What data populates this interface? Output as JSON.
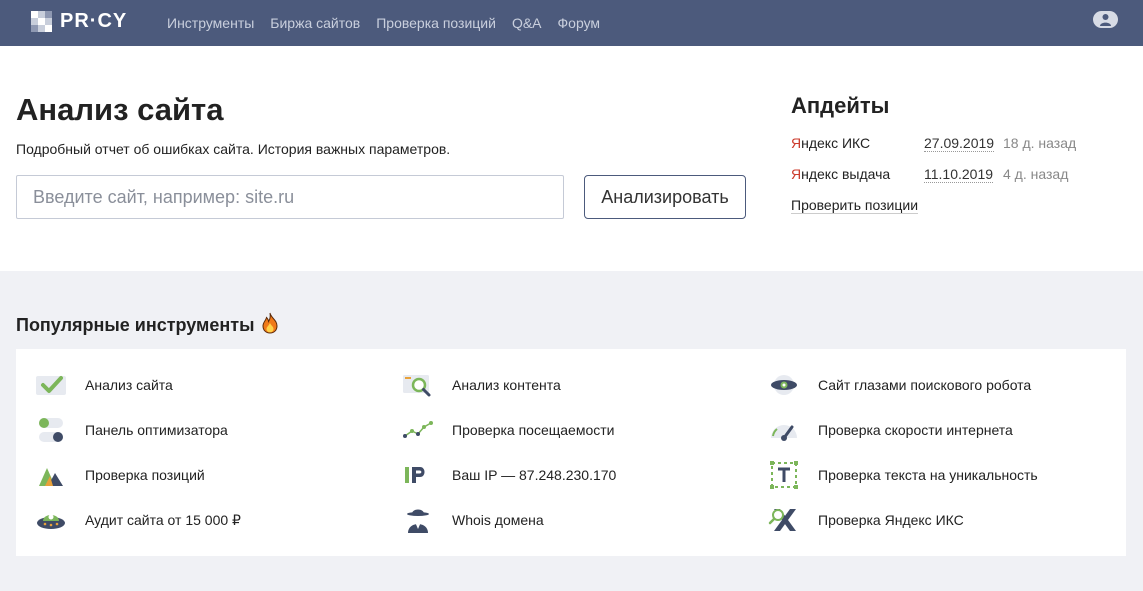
{
  "brand": {
    "name": "PR·CY"
  },
  "nav": {
    "items": [
      {
        "label": "Инструменты"
      },
      {
        "label": "Биржа сайтов"
      },
      {
        "label": "Проверка позиций"
      },
      {
        "label": "Q&A"
      },
      {
        "label": "Форум"
      }
    ]
  },
  "hero": {
    "title": "Анализ сайта",
    "subtitle": "Подробный отчет об ошибках сайта. История важных параметров.",
    "input_placeholder": "Введите сайт, например: site.ru",
    "input_value": "",
    "button_label": "Анализировать"
  },
  "updates": {
    "title": "Апдейты",
    "rows": [
      {
        "name_prefix": "Я",
        "name_rest": "ндекс ИКС",
        "date": "27.09.2019",
        "ago": "18 д. назад"
      },
      {
        "name_prefix": "Я",
        "name_rest": "ндекс выдача",
        "date": "11.10.2019",
        "ago": "4 д. назад"
      }
    ],
    "check_link": "Проверить позиции"
  },
  "popular": {
    "title": "Популярные инструменты",
    "icon": "fire-icon",
    "tools": [
      {
        "label": "Анализ сайта",
        "icon": "checkmark-icon"
      },
      {
        "label": "Панель оптимизатора",
        "icon": "toggle-icon"
      },
      {
        "label": "Проверка позиций",
        "icon": "mountains-icon"
      },
      {
        "label": "Аудит сайта от 15 000 ₽",
        "icon": "ufo-icon"
      },
      {
        "label": "Анализ контента",
        "icon": "magnifier-icon"
      },
      {
        "label": "Проверка посещаемости",
        "icon": "line-graph-icon"
      },
      {
        "label": "Ваш IP — 87.248.230.170",
        "icon": "ip-icon"
      },
      {
        "label": "Whois домена",
        "icon": "detective-icon"
      },
      {
        "label": "Сайт глазами поискового робота",
        "icon": "robot-eye-icon"
      },
      {
        "label": "Проверка скорости интернета",
        "icon": "speedometer-icon"
      },
      {
        "label": "Проверка текста на уникальность",
        "icon": "text-frame-icon"
      },
      {
        "label": "Проверка Яндекс ИКС",
        "icon": "yandex-x-icon"
      }
    ]
  },
  "colors": {
    "topbar": "#4c5a7c",
    "accent_green": "#7cb65a",
    "accent_dark": "#3f4b66",
    "yandex_red": "#cc3a2b"
  }
}
